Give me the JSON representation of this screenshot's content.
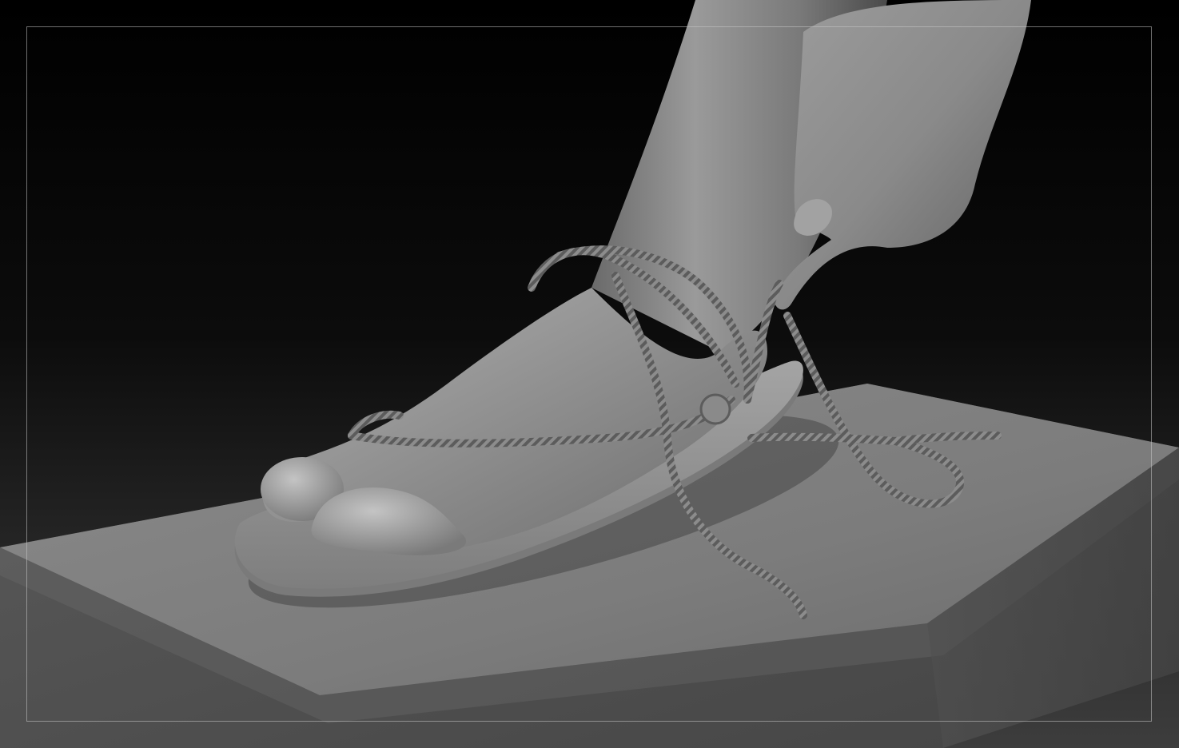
{
  "viewport": {
    "background_top": "#000000",
    "background_bottom": "#4a4a4a",
    "frame_color": "#bdbdbd"
  },
  "render": {
    "material": "matte grey clay",
    "subject": [
      "leg",
      "hand",
      "foot",
      "sandal-sole",
      "rope-laces",
      "pedestal-block"
    ]
  }
}
